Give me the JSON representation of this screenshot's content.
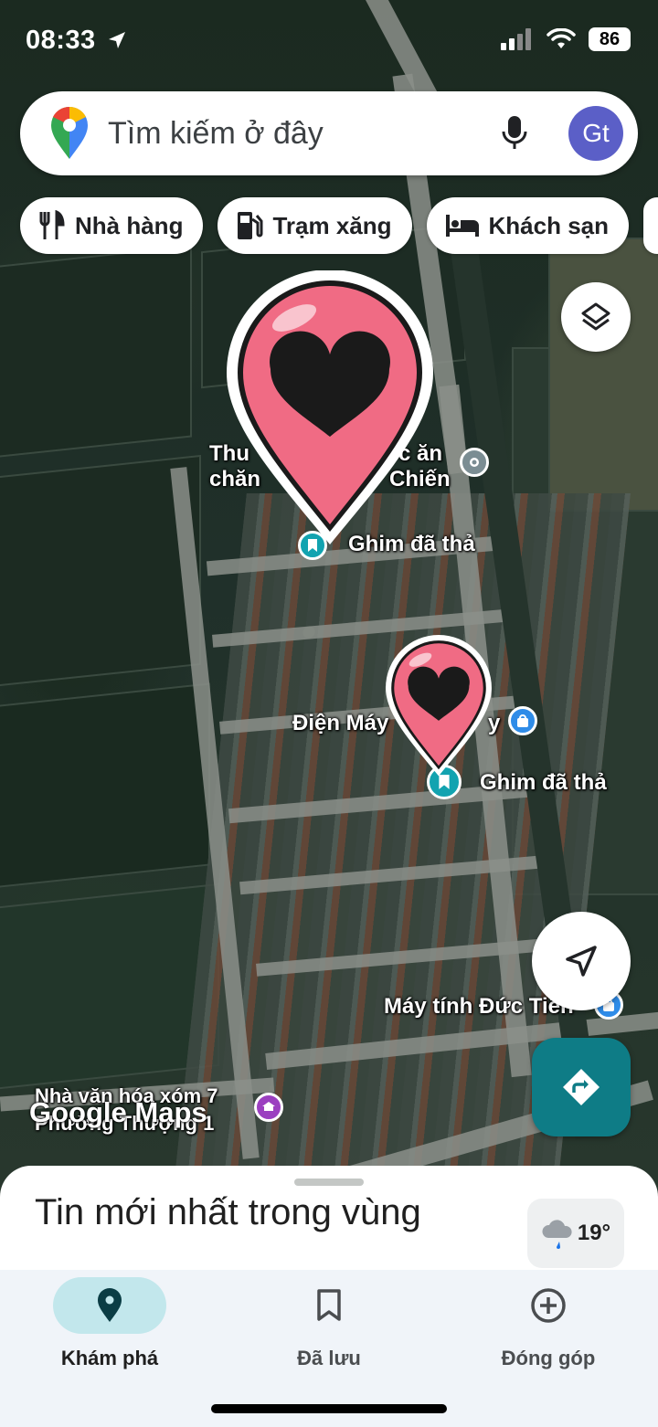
{
  "status_bar": {
    "time": "08:33",
    "battery": "86"
  },
  "search": {
    "placeholder": "Tìm kiếm ở đây",
    "avatar_initials": "Gt"
  },
  "chips": [
    {
      "label": "Nhà hàng",
      "icon": "restaurant-icon"
    },
    {
      "label": "Trạm xăng",
      "icon": "gas-station-icon"
    },
    {
      "label": "Khách sạn",
      "icon": "hotel-icon"
    }
  ],
  "map": {
    "labels": {
      "feed_store_1": "Thu",
      "feed_store_2": "c ăn",
      "feed_store_3": "chăn",
      "feed_store_4": "Chiến",
      "pin1": "Ghim đã thả",
      "electronics": "Điện Máy",
      "electronics_tail": "y",
      "pin2": "Ghim đã thả",
      "computer_shop": "Máy tính Đức Tiến",
      "culture_house_1": "Nhà văn hóa xóm 7",
      "culture_house_2": "Phường Thượng 1"
    },
    "watermark": "Google Maps"
  },
  "sheet": {
    "title": "Tin mới nhất trong vùng",
    "temperature": "19°"
  },
  "nav": [
    {
      "label": "Khám phá",
      "icon": "location-pin-icon",
      "active": true
    },
    {
      "label": "Đã lưu",
      "icon": "bookmark-icon",
      "active": false
    },
    {
      "label": "Đóng góp",
      "icon": "plus-circle-icon",
      "active": false
    }
  ],
  "colors": {
    "accent": "#0e7c86",
    "pin_pink": "#f06b84",
    "active_nav_bg": "#c2e7ec"
  }
}
